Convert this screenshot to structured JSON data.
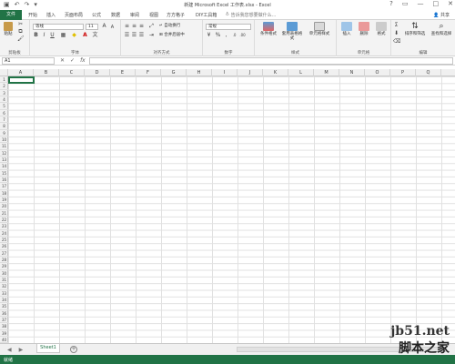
{
  "titlebar": {
    "title": "新建 Microsoft Excel 工作表.xlsx - Excel",
    "qat": [
      "save-icon",
      "undo-icon",
      "redo-icon",
      "customize-icon"
    ],
    "window_buttons": [
      "?",
      "▭",
      "—",
      "□",
      "✕"
    ]
  },
  "tabs": {
    "file": "文件",
    "items": [
      "开始",
      "插入",
      "页面布局",
      "公式",
      "数据",
      "审阅",
      "视图",
      "方方格子",
      "DIY工具箱"
    ],
    "tellme": "告诉我您想要做什么...",
    "share": "共享"
  },
  "ribbon": {
    "clipboard": {
      "paste": "粘贴",
      "label": "剪贴板"
    },
    "font": {
      "name": "等线",
      "size": "11",
      "grow": "A",
      "shrink": "A",
      "bold": "B",
      "italic": "I",
      "underline": "U",
      "color": "A",
      "label": "字体"
    },
    "alignment": {
      "wrap": "自动换行",
      "merge": "合并后居中",
      "label": "对齐方式"
    },
    "number": {
      "format": "常规",
      "percent": "%",
      "comma": ",",
      "label": "数字"
    },
    "styles": {
      "cond": "条件格式",
      "table": "套用表格格式",
      "cell": "单元格样式",
      "label": "样式"
    },
    "cells": {
      "insert": "插入",
      "delete": "删除",
      "format": "格式",
      "label": "单元格"
    },
    "editing": {
      "sigma": "Σ",
      "sort": "排序和筛选",
      "find": "查找和选择",
      "label": "编辑"
    }
  },
  "formula_bar": {
    "name_box": "A1",
    "cancel": "✕",
    "enter": "✓",
    "fx": "fx",
    "value": ""
  },
  "columns": [
    "A",
    "B",
    "C",
    "D",
    "E",
    "F",
    "G",
    "H",
    "I",
    "J",
    "K",
    "L",
    "M",
    "N",
    "O",
    "P",
    "Q"
  ],
  "rows": [
    "1",
    "2",
    "3",
    "4",
    "5",
    "6",
    "7",
    "8",
    "9",
    "10",
    "11",
    "12",
    "13",
    "14",
    "15",
    "16",
    "17",
    "18",
    "19",
    "20",
    "21",
    "22",
    "23",
    "24",
    "25",
    "26",
    "27",
    "28",
    "29",
    "30",
    "31",
    "32",
    "33",
    "34",
    "35",
    "36",
    "37",
    "38",
    "39",
    "40"
  ],
  "sheetbar": {
    "prev": "◀",
    "next": "▶",
    "sheet": "Sheet1",
    "add": "+"
  },
  "statusbar": {
    "ready": "就绪"
  },
  "watermark": {
    "line1": "jb51.net",
    "line2": "脚本之家"
  },
  "colors": {
    "accent": "#217346"
  }
}
